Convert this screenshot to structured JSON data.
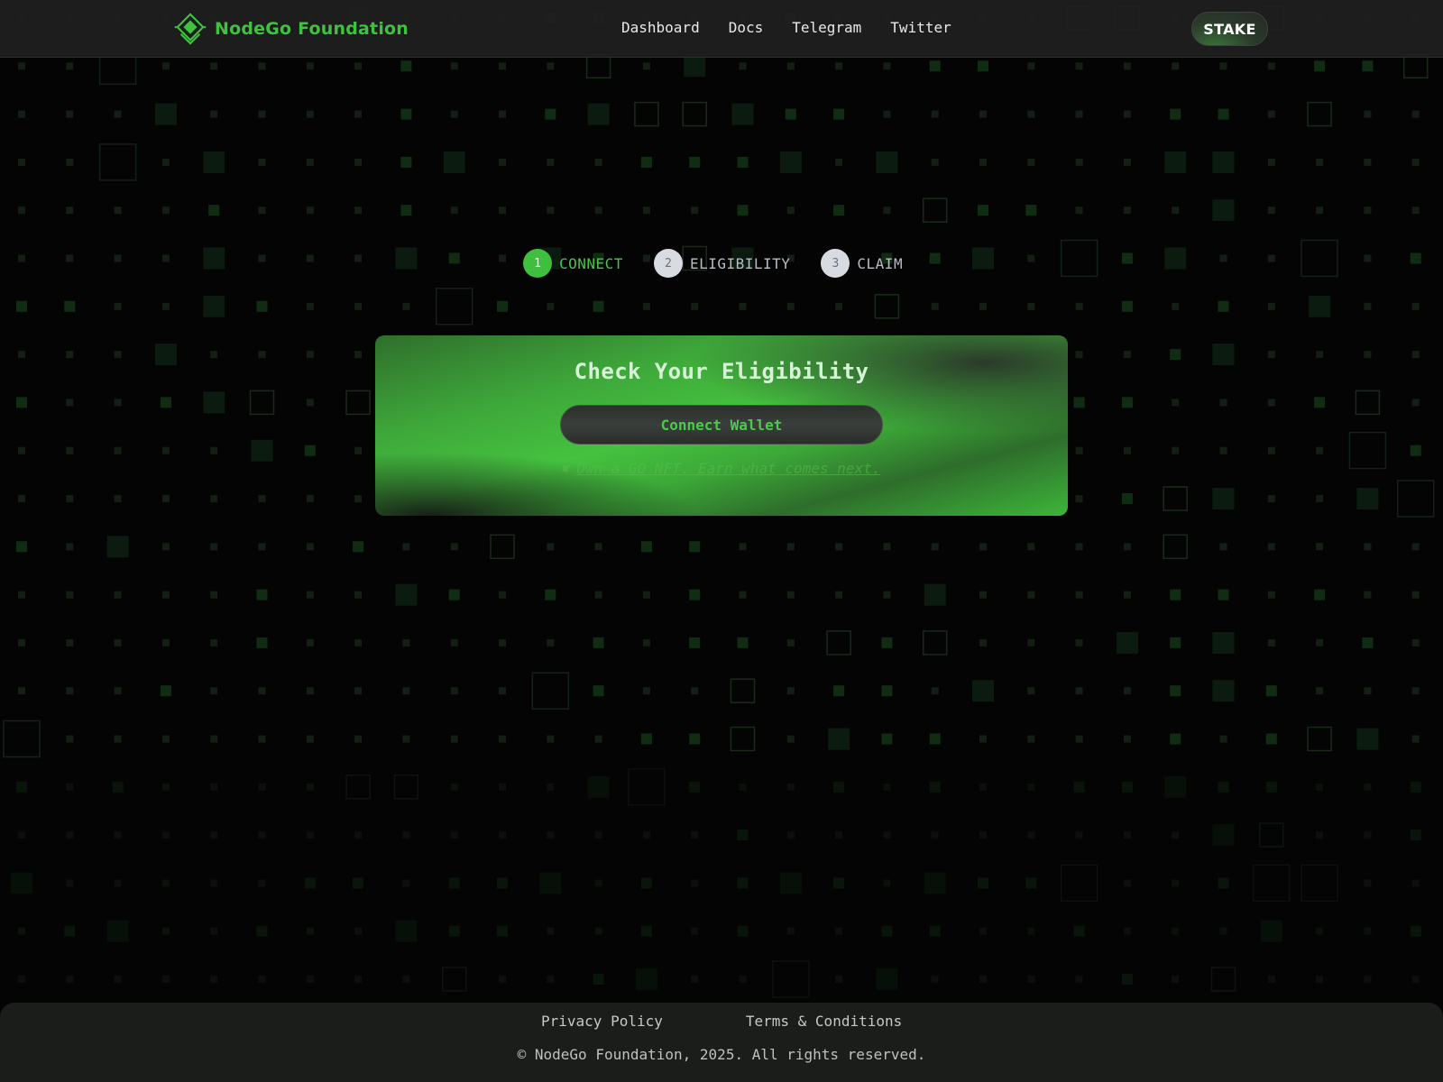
{
  "brand": {
    "name": "NodeGo Foundation",
    "color": "#3fc23f"
  },
  "nav": {
    "items": [
      {
        "label": "Dashboard"
      },
      {
        "label": "Docs"
      },
      {
        "label": "Telegram"
      },
      {
        "label": "Twitter"
      }
    ],
    "stake_label": "STAKE"
  },
  "stepper": {
    "steps": [
      {
        "number": "1",
        "label": "CONNECT",
        "state": "active"
      },
      {
        "number": "2",
        "label": "ELIGIBILITY",
        "state": "inactive"
      },
      {
        "number": "3",
        "label": "CLAIM",
        "state": "inactive"
      }
    ]
  },
  "card": {
    "title": "Check Your Eligibility",
    "button_label": "Connect Wallet",
    "link_icon": "pointing-hand-icon",
    "link_text": "Own a GO NFT. Earn what comes next."
  },
  "footer": {
    "links": [
      {
        "label": "Privacy Policy"
      },
      {
        "label": "Terms & Conditions"
      }
    ],
    "copyright": "© NodeGo Foundation, 2025. All rights reserved."
  },
  "colors": {
    "accent": "#3fc23f",
    "background": "#030403",
    "header": "#1e201e",
    "inactive_step": "#d8dbe0"
  }
}
